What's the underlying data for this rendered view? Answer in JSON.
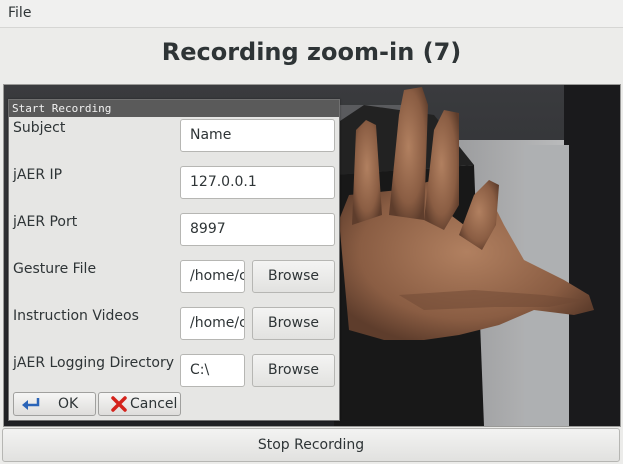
{
  "menubar": {
    "file_label": "File"
  },
  "header": {
    "title": "Recording zoom-in (7)"
  },
  "dialog": {
    "title": "Start Recording",
    "fields": [
      {
        "label": "Subject",
        "value": "Name"
      },
      {
        "label": "jAER IP",
        "value": "127.0.0.1"
      },
      {
        "label": "jAER Port",
        "value": "8997"
      },
      {
        "label": "Gesture File",
        "value": "/home/c",
        "browse_label": "Browse"
      },
      {
        "label": "Instruction Videos",
        "value": "/home/c",
        "browse_label": "Browse"
      },
      {
        "label": "jAER Logging Directory",
        "value": "C:\\",
        "browse_label": "Browse"
      }
    ],
    "ok_label": "OK",
    "cancel_label": "Cancel"
  },
  "footer": {
    "stop_label": "Stop Recording"
  },
  "colors": {
    "dialog_title_bg": "#5a5a5a",
    "cancel_icon": "#d4231c",
    "ok_icon": "#2a64b8"
  }
}
